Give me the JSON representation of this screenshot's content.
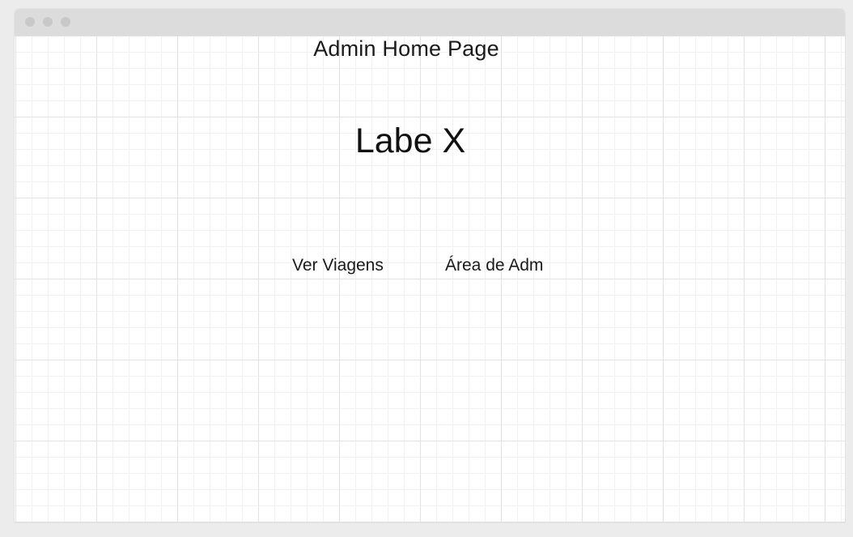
{
  "page": {
    "title": "Admin Home Page",
    "brand": "Labe X"
  },
  "nav": {
    "items": [
      {
        "label": "Ver Viagens"
      },
      {
        "label": "Área de Adm"
      }
    ]
  }
}
